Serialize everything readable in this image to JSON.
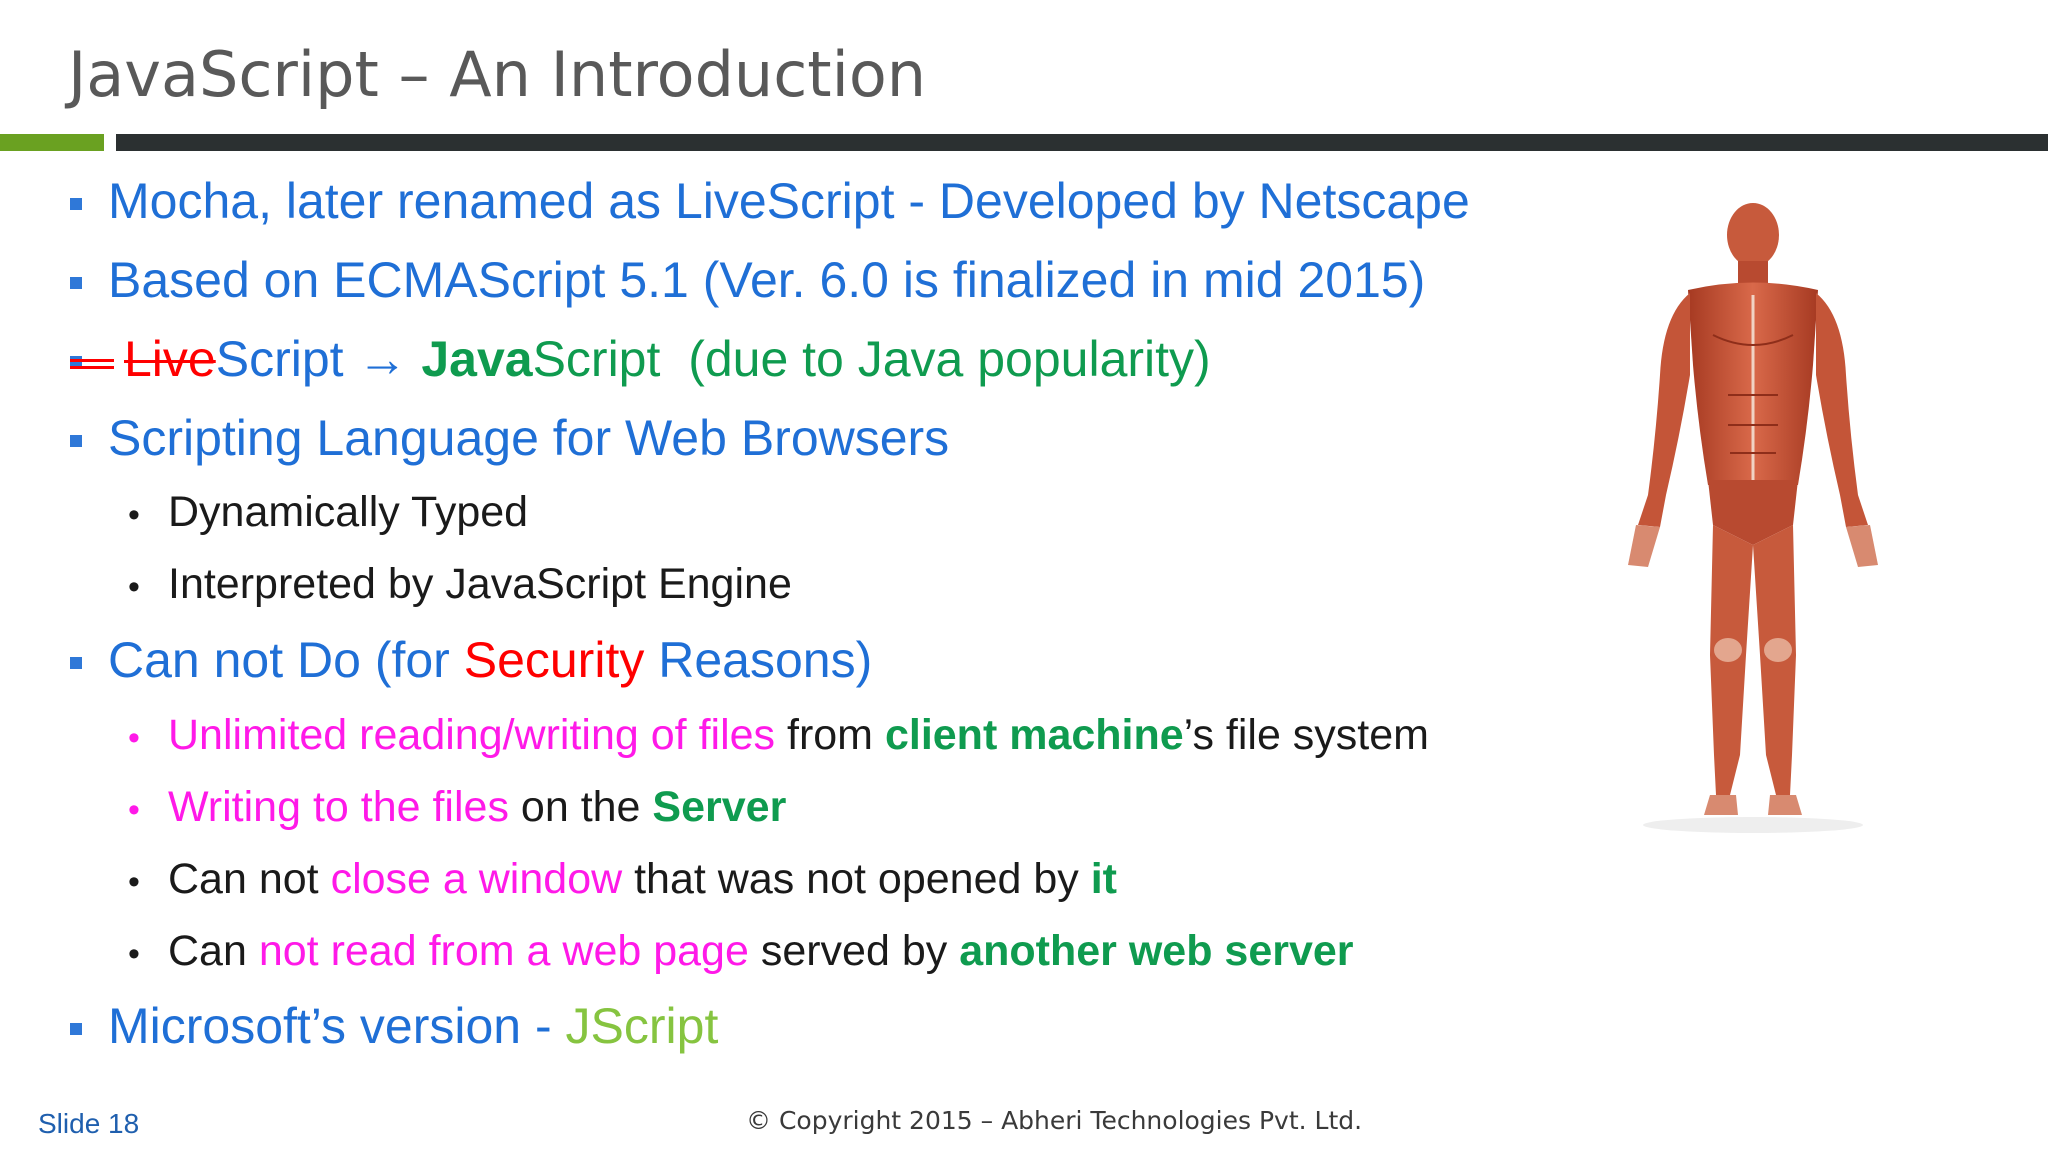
{
  "title": "JavaScript – An Introduction",
  "bullets": {
    "b1": "Mocha, later renamed as LiveScript - Developed by Netscape",
    "b2": "Based on ECMAScript 5.1 (Ver. 6.0 is finalized in mid 2015)",
    "b3": {
      "live": "Live",
      "script1": "Script ",
      "arrow": "→",
      "java": "Java",
      "script2": "Script",
      "note": "(due to Java popularity)"
    },
    "b4": "Scripting Language for Web Browsers",
    "b4_sub": [
      "Dynamically Typed",
      "Interpreted by JavaScript Engine"
    ],
    "b5": {
      "pre": "Can not Do (for ",
      "security": "Security",
      "post": " Reasons)"
    },
    "b5_sub1": {
      "a": "Unlimited reading/writing of files",
      "b": " from ",
      "c": "client machine",
      "d": "’s file system"
    },
    "b5_sub2": {
      "a": "Writing to the files",
      "b": " on the ",
      "c": "Server"
    },
    "b5_sub3": {
      "a": "Can not ",
      "b": "close a window",
      "c": " that was not opened by ",
      "d": "it"
    },
    "b5_sub4": {
      "a": "Can ",
      "b": "not read from a web page",
      "c": " served by ",
      "d": "another web server"
    },
    "b6": {
      "a": "Microsoft’s version - ",
      "b": "JScript"
    }
  },
  "footer": {
    "slide": "Slide 18",
    "copyright": "© Copyright 2015 – Abheri Technologies Pvt. Ltd."
  },
  "colors": {
    "blue": "#1f6fd6",
    "red": "#ff0000",
    "green": "#0f9b4f",
    "pink": "#ff19e8",
    "lime": "#86c440",
    "accent_bar_green": "#6aa121",
    "accent_bar_dark": "#2b3031"
  },
  "image": "human-muscle-anatomy-figure"
}
